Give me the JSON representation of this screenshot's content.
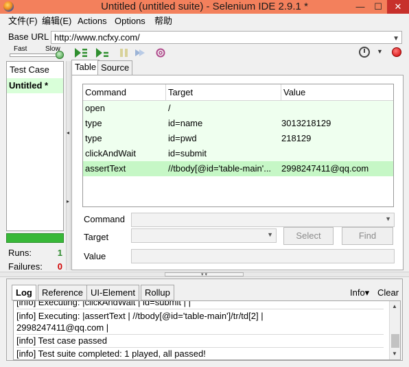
{
  "window": {
    "title": "Untitled (untitled suite) - Selenium IDE 2.9.1 *",
    "minimize_glyph": "—",
    "maximize_glyph": "☐",
    "close_glyph": "✕"
  },
  "menu": {
    "items": [
      "文件(F)",
      "编辑(E)",
      "Actions",
      "Options",
      "帮助"
    ]
  },
  "base_url": {
    "label": "Base URL",
    "value": "http://www.ncfxy.com/"
  },
  "toolbar": {
    "speed_fast": "Fast",
    "speed_slow": "Slow",
    "icons": [
      "play-suite-icon",
      "play-test-icon",
      "pause-icon",
      "step-icon",
      "rollup-icon"
    ],
    "colors": {
      "play": "#2f8f2f",
      "pause": "#c8c28a",
      "step": "#9bb3d6",
      "rollup": "#b04a8c",
      "record": "#d00000"
    }
  },
  "test_case_pane": {
    "header": "Test Case",
    "items": [
      {
        "label": "Untitled *"
      }
    ],
    "progress_color": "#38b838",
    "runs_label": "Runs:",
    "runs_value": "1",
    "runs_color": "#2e8a2e",
    "failures_label": "Failures:",
    "failures_value": "0",
    "failures_color": "#d00000"
  },
  "editor": {
    "tabs": [
      "Table",
      "Source"
    ],
    "columns": [
      "Command",
      "Target",
      "Value"
    ],
    "rows": [
      {
        "command": "open",
        "target": "/",
        "value": ""
      },
      {
        "command": "type",
        "target": "id=name",
        "value": "3013218129"
      },
      {
        "command": "type",
        "target": "id=pwd",
        "value": "218129"
      },
      {
        "command": "clickAndWait",
        "target": "id=submit",
        "value": ""
      },
      {
        "command": "assertText",
        "target": "//tbody[@id='table-main'...",
        "value": "2998247411@qq.com"
      }
    ],
    "command_label": "Command",
    "target_label": "Target",
    "value_label": "Value",
    "select_button": "Select",
    "find_button": "Find"
  },
  "log_panel": {
    "tabs": [
      "Log",
      "Reference",
      "UI-Element",
      "Rollup"
    ],
    "info_label": "Info▾",
    "clear_label": "Clear",
    "lines": [
      "[info] Executing: |clickAndWait | id=submit | |",
      "[info] Executing: |assertText | //tbody[@id='table-main']/tr/td[2] |",
      "2998247411@qq.com |",
      "[info] Test case passed",
      "[info] Test suite completed: 1 played, all passed!"
    ]
  }
}
